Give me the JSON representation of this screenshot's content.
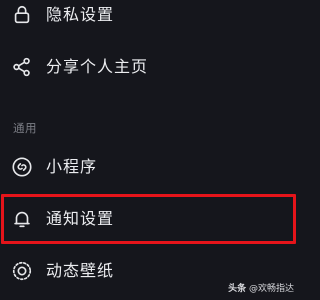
{
  "menu": {
    "items": [
      {
        "icon": "lock-icon",
        "label": "隐私设置"
      },
      {
        "icon": "share-icon",
        "label": "分享个人主页"
      }
    ]
  },
  "general": {
    "section_title": "通用",
    "items": [
      {
        "icon": "link-icon",
        "label": "小程序"
      },
      {
        "icon": "bell-icon",
        "label": "通知设置"
      },
      {
        "icon": "live-wallpaper-icon",
        "label": "动态壁纸"
      }
    ]
  },
  "highlight": {
    "target": "通知设置",
    "color": "#e5141a"
  },
  "colors": {
    "background": "#15161c",
    "text": "#ecedf0",
    "section_text": "#7b7d85",
    "icon": "#e6e7ea"
  },
  "watermark": {
    "brand": "头条",
    "author": "@欢畅指达"
  }
}
